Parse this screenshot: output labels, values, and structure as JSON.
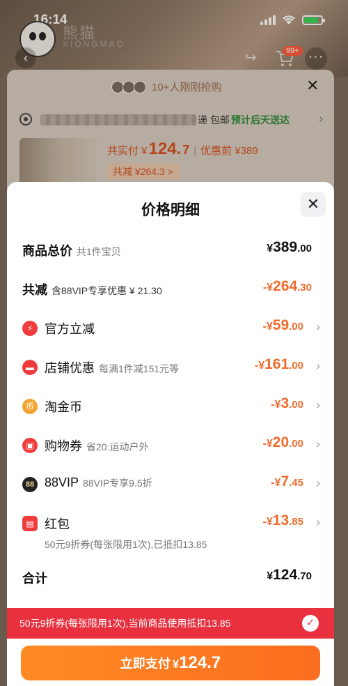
{
  "status_bar": {
    "time": "16:14"
  },
  "background": {
    "brand_name": "熊猫",
    "brand_sub": "XIONGMAO",
    "cart_badge": "99+",
    "buyers_text": "10+人刚刚抢购",
    "shipping": "递 包邮",
    "eta": "预计后天送达",
    "price_prefix": "共实付 ¥",
    "price_int": "124.",
    "price_dec": "7",
    "price_before": "优惠前 ¥389",
    "reduce_total": "共减 ¥264.3 >"
  },
  "sheet": {
    "title": "价格明细",
    "rows": [
      {
        "label": "商品总价",
        "sub": "共1件宝贝",
        "currency": "¥",
        "amount_int": "389",
        "amount_dec": ".00"
      },
      {
        "label": "共减",
        "sub": "含88VIP专享优惠 ¥ 21.30",
        "currency": "-¥",
        "amount_int": "264",
        "amount_dec": ".30"
      },
      {
        "label": "官方立减",
        "sub": "",
        "currency": "-¥",
        "amount_int": "59",
        "amount_dec": ".00"
      },
      {
        "label": "店铺优惠",
        "sub": "每满1件减151元等",
        "currency": "-¥",
        "amount_int": "161",
        "amount_dec": ".00"
      },
      {
        "label": "淘金币",
        "sub": "",
        "currency": "-¥",
        "amount_int": "3",
        "amount_dec": ".00"
      },
      {
        "label": "购物券",
        "sub": "省20:运动户外",
        "currency": "-¥",
        "amount_int": "20",
        "amount_dec": ".00"
      },
      {
        "label": "88VIP",
        "sub": "88VIP专享9.5折",
        "currency": "-¥",
        "amount_int": "7",
        "amount_dec": ".45"
      },
      {
        "label": "红包",
        "sub": "",
        "note": "50元9折券(每张限用1次),已抵扣13.85",
        "currency": "-¥",
        "amount_int": "13",
        "amount_dec": ".85"
      }
    ],
    "total": {
      "label": "合计",
      "currency": "¥",
      "amount_int": "124",
      "amount_dec": ".70"
    },
    "icons": {
      "official": "⚡",
      "store": "▬",
      "coin": "币",
      "coupon": "▣",
      "vip": "88",
      "redpacket": "▤"
    }
  },
  "banner": {
    "text": "50元9折券(每张限用1次),当前商品使用抵扣13.85"
  },
  "pay_button": {
    "label": "立即支付",
    "currency": "¥",
    "amount": "124.7"
  },
  "colors": {
    "accent": "#ef6b2c",
    "banner": "#e8303f",
    "pay": "#fb6d1f"
  }
}
